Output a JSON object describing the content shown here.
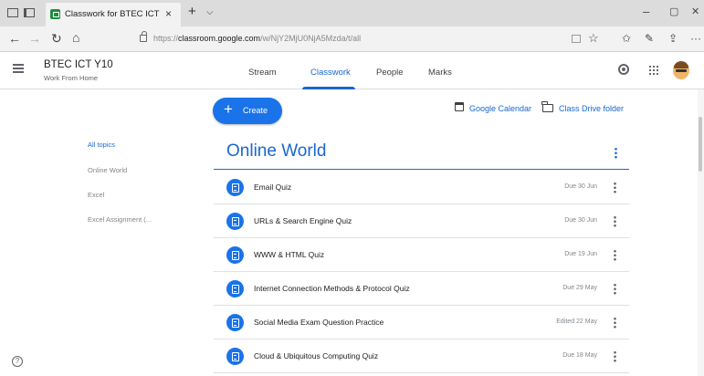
{
  "browser": {
    "tab_title": "Classwork for BTEC ICT",
    "tab_close": "×",
    "new_tab": "+",
    "tab_menu": "⌵",
    "url_prefix": "https://",
    "url_host": "classroom.google.com",
    "url_path": "/w/NjY2MjU0NjA5Mzda/t/all",
    "window_min": "–",
    "window_max": "▢",
    "window_close": "✕",
    "nav_back": "←",
    "nav_forward": "→",
    "nav_reload": "↻",
    "nav_home": "⌂",
    "favorite": "☆",
    "favorites_bar": "✩",
    "pen": "✎",
    "share": "⇪",
    "more": "···"
  },
  "header": {
    "class_name": "BTEC ICT Y10",
    "class_subtitle": "Work From Home",
    "tabs": [
      {
        "label": "Stream",
        "active": false
      },
      {
        "label": "Classwork",
        "active": true
      },
      {
        "label": "People",
        "active": false
      },
      {
        "label": "Marks",
        "active": false
      }
    ]
  },
  "toolbar": {
    "create_plus": "+",
    "create_label": "Create",
    "calendar_link": "Google Calendar",
    "drive_link": "Class Drive folder"
  },
  "topics": [
    {
      "label": "All topics",
      "active": true
    },
    {
      "label": "Online World",
      "active": false
    },
    {
      "label": "Excel",
      "active": false
    },
    {
      "label": "Excel Assignment (...",
      "active": false
    }
  ],
  "section": {
    "title": "Online World",
    "items": [
      {
        "title": "Email Quiz",
        "due": "Due 30 Jun"
      },
      {
        "title": "URLs & Search Engine Quiz",
        "due": "Due 30 Jun"
      },
      {
        "title": "WWW & HTML Quiz",
        "due": "Due 19 Jun"
      },
      {
        "title": "Internet Connection Methods & Protocol Quiz",
        "due": "Due 29 May"
      },
      {
        "title": "Social Media Exam Question Practice",
        "due": "Edited 22 May"
      },
      {
        "title": "Cloud & Ubiquitous Computing Quiz",
        "due": "Due 18 May"
      }
    ]
  },
  "help": "?",
  "colors": {
    "accent": "#1967d2",
    "create_button": "#1a73e8",
    "assignment_icon": "#1a73e8"
  }
}
